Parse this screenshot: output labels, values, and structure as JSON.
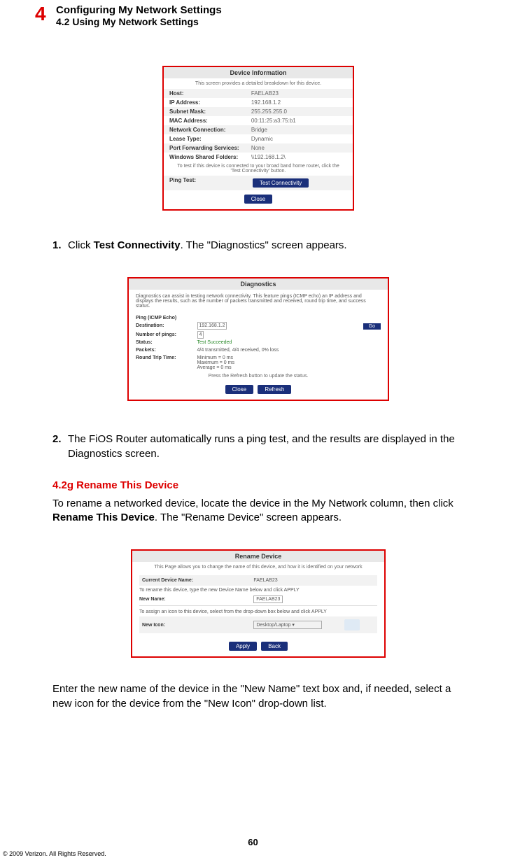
{
  "header": {
    "chapter_num": "4",
    "title": "Configuring My Network Settings",
    "subtitle": "4.2  Using My Network Settings"
  },
  "fig1": {
    "title": "Device Information",
    "subtitle": "This screen provides a detailed breakdown for this device.",
    "rows": [
      {
        "k": "Host:",
        "v": "FAELAB23"
      },
      {
        "k": "IP Address:",
        "v": "192.168.1.2"
      },
      {
        "k": "Subnet Mask:",
        "v": "255.255.255.0"
      },
      {
        "k": "MAC Address:",
        "v": "00:11:25:a3:75:b1"
      },
      {
        "k": "Network Connection:",
        "v": "Bridge"
      },
      {
        "k": "Lease Type:",
        "v": "Dynamic"
      },
      {
        "k": "Port Forwarding Services:",
        "v": "None"
      },
      {
        "k": "Windows Shared Folders:",
        "v": "\\\\192.168.1.2\\"
      }
    ],
    "note": "To test if this device is connected to your broad band home router, click the 'Test Connectivity' button.",
    "ping_label": "Ping Test:",
    "test_btn": "Test Connectivity",
    "close_btn": "Close"
  },
  "step1": {
    "num": "1.",
    "pre": "Click ",
    "bold": "Test Connectivity",
    "post": ". The \"Diagnostics\" screen appears."
  },
  "fig2": {
    "title": "Diagnostics",
    "intro": "Diagnostics can assist in testing network connectivity. This feature pings (ICMP echo) an IP address and displays the results, such as the number of packets transmitted and received, round trip time, and success status.",
    "ping_heading": "Ping (ICMP Echo)",
    "dest_label": "Destination:",
    "dest_value": "192.168.1.2",
    "go_btn": "Go",
    "num_label": "Number of pings:",
    "num_value": "4",
    "status_label": "Status:",
    "status_value": "Test Succeeded",
    "packets_label": "Packets:",
    "packets_value": "4/4 transmitted, 4/4 received, 0% loss",
    "rtt_label": "Round Trip Time:",
    "rtt_min": "Minimum = 0 ms",
    "rtt_max": "Maximum = 0 ms",
    "rtt_avg": "Average = 0 ms",
    "refresh_note": "Press the Refresh button to update the status.",
    "close_btn": "Close",
    "refresh_btn": "Refresh"
  },
  "step2": {
    "num": "2.",
    "text": "The FiOS Router automatically runs a ping test, and the results are displayed in the Diagnostics screen."
  },
  "section": {
    "heading": "4.2g  Rename This Device",
    "p1_pre": "To rename a networked device, locate the device in the My Network column, then click ",
    "p1_bold": "Rename This Device",
    "p1_post": ". The \"Rename Device\" screen appears."
  },
  "fig3": {
    "title": "Rename Device",
    "subtitle": "This Page allows you to change the name of this device, and how it is identified on your network",
    "cur_label": "Current Device Name:",
    "cur_value": "FAELAB23",
    "rename_note": "To rename this device, type the new Device Name below and click APPLY",
    "new_name_label": "New Name:",
    "new_name_value": "FAELAB23",
    "icon_note": "To assign an icon to this device, select from the drop-down box below and click APPLY",
    "new_icon_label": "New Icon:",
    "new_icon_value": "Desktop/Laptop ▾",
    "apply_btn": "Apply",
    "back_btn": "Back"
  },
  "para_last": "Enter the new name of the device in the \"New Name\" text box and, if needed, select a new icon for the device from the \"New Icon\" drop-down list.",
  "footer": {
    "page": "60",
    "copyright": "© 2009 Verizon. All Rights Reserved."
  }
}
